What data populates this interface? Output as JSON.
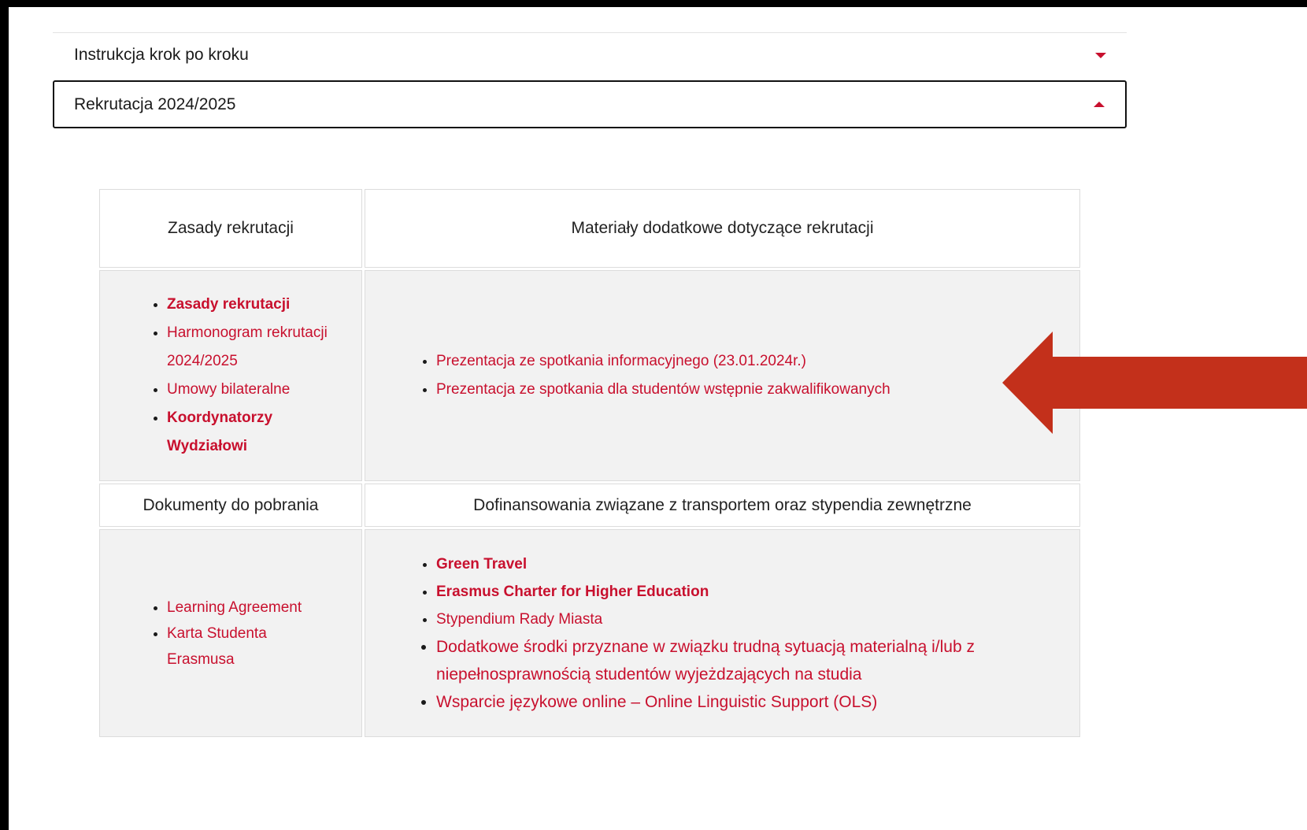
{
  "accordion": [
    {
      "label": "Instrukcja krok po kroku",
      "state": "collapsed"
    },
    {
      "label": "Rekrutacja 2024/2025",
      "state": "expanded"
    }
  ],
  "table": {
    "col1_header": "Zasady rekrutacji",
    "col2_header": "Materiały dodatkowe dotyczące rekrutacji",
    "col1_links": [
      {
        "text": "Zasady rekrutacji",
        "bold": true
      },
      {
        "text": "Harmonogram rekrutacji 2024/2025",
        "bold": false
      },
      {
        "text": "Umowy bilateralne",
        "bold": false
      },
      {
        "text": "Koordynatorzy Wydziałowi",
        "bold": true
      }
    ],
    "col2_links": [
      {
        "text": "Prezentacja ze spotkania informacyjnego (23.01.2024r.)"
      },
      {
        "text": "Prezentacja ze spotkania dla studentów wstępnie zakwalifikowanych"
      }
    ],
    "col3_header": "Dokumenty do pobrania",
    "col4_header": "Dofinansowania związane z transportem oraz stypendia zewnętrzne",
    "col3_links": [
      {
        "text": "Learning Agreement"
      },
      {
        "text": "Karta Studenta Erasmusa"
      }
    ],
    "col4_links": [
      {
        "text": "Green Travel",
        "bold": true
      },
      {
        "text": "Erasmus Charter for Higher Education",
        "bold": true
      },
      {
        "text": "Stypendium Rady Miasta"
      },
      {
        "text": "Dodatkowe środki przyznane w związku trudną sytuacją materialną i/lub z niepełnosprawnością studentów wyjeżdzających na studia"
      },
      {
        "text": "Wsparcie językowe online – Online Linguistic Support (OLS)"
      }
    ]
  },
  "colors": {
    "accent": "#c8102e",
    "annotation_arrow": "#c3301b"
  }
}
